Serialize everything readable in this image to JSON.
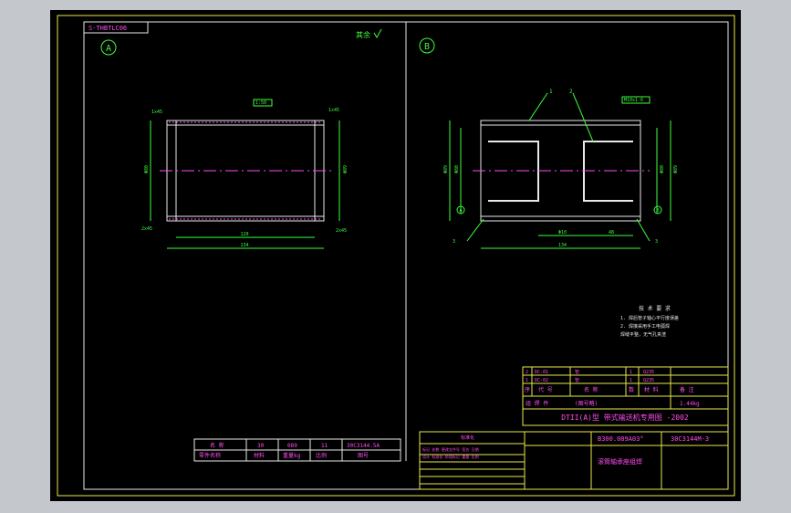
{
  "header_tag": "S-THBTLC06",
  "view_a_label": "A",
  "view_b_label": "B",
  "roughness_note": "其余",
  "view_a": {
    "diameter_left": "Φ80",
    "diameter_right": "Φ89",
    "chamfer_tl": "1x45",
    "chamfer_tr": "1x45",
    "thread_label": "1:50",
    "length_inner": "120",
    "length_total": "134",
    "chamfer_bl": "2x45",
    "chamfer_br": "2x45"
  },
  "view_b": {
    "leader_1": "1",
    "leader_2": "2",
    "thread_label": "M10x1-6",
    "dim_left_outer": "Φ89",
    "dim_left_inner": "Φ80",
    "dim_right_inner": "Φ80",
    "dim_right_outer": "Φ89",
    "marker_a": "A",
    "marker_b": "B",
    "weld_left": "3",
    "weld_right": "3",
    "dim_center": "Φ10",
    "dim_right_seg": "48",
    "dim_total": "134"
  },
  "tech_requirements": {
    "title": "技 术 要 求",
    "lines": [
      "1. 焊后管子轴心平行度误差",
      "2. 焊接采用手工电弧焊",
      "  焊缝平整，无气孔夹渣"
    ]
  },
  "bom": {
    "rows": [
      [
        "2",
        "DC-01",
        "管",
        "1",
        "Q235"
      ],
      [
        "1",
        "DC-02",
        "管",
        "1",
        "Q235"
      ]
    ],
    "header": [
      "序",
      "代 号",
      "名 称",
      "数",
      "材 料",
      "备 注"
    ],
    "material_row": [
      "组 焊 件",
      "(图号略)",
      "1.44kg"
    ],
    "series_title": "DTII(A)型 带式输送机专用图 -2002",
    "drawing_code": "B300.089A03°",
    "part_code": "30C3144M-3",
    "part_name": "滚筒轴承座组焊"
  },
  "small_table": {
    "row1": [
      "名 称",
      "30",
      "089",
      "11",
      "30C3144.5A"
    ],
    "row2": [
      "零件名称",
      "材料",
      "重量kg",
      "比例",
      "图号"
    ]
  },
  "process_table": {
    "title": "标准化",
    "lines": [
      "标记 处数 更改文件号 签名 日期",
      "设计 标准化 阶段标记 重量 比例"
    ]
  }
}
